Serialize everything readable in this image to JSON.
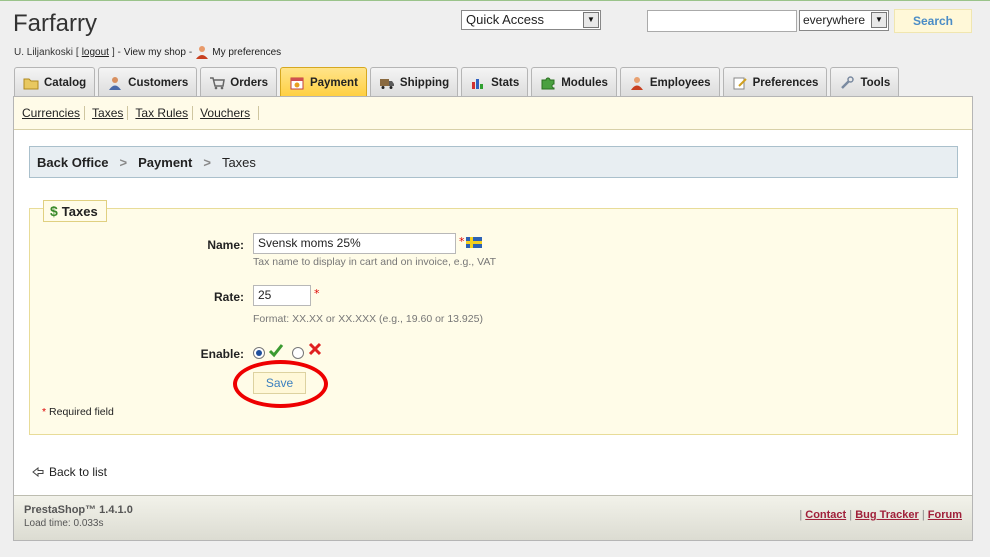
{
  "header": {
    "shop_name": "Farfarry",
    "user_name": "U. Liljankoski",
    "logout_open": "[",
    "logout_label": "logout",
    "logout_close": "] -",
    "view_shop_label": "View my shop",
    "dash": "-",
    "preferences_label": "My preferences",
    "quick_access_label": "Quick Access",
    "search_value": "",
    "search_scope": "everywhere",
    "search_button": "Search"
  },
  "tabs": [
    {
      "label": "Catalog",
      "icon": "folder-icon",
      "active": false
    },
    {
      "label": "Customers",
      "icon": "customers-icon",
      "active": false
    },
    {
      "label": "Orders",
      "icon": "cart-icon",
      "active": false
    },
    {
      "label": "Payment",
      "icon": "payment-icon",
      "active": true
    },
    {
      "label": "Shipping",
      "icon": "truck-icon",
      "active": false
    },
    {
      "label": "Stats",
      "icon": "chart-icon",
      "active": false
    },
    {
      "label": "Modules",
      "icon": "puzzle-icon",
      "active": false
    },
    {
      "label": "Employees",
      "icon": "employee-icon",
      "active": false
    },
    {
      "label": "Preferences",
      "icon": "preferences-icon",
      "active": false
    },
    {
      "label": "Tools",
      "icon": "wrench-icon",
      "active": false
    }
  ],
  "subnav": [
    "Currencies",
    "Taxes",
    "Tax Rules",
    "Vouchers"
  ],
  "breadcrumb": {
    "root": "Back Office",
    "section": "Payment",
    "current": "Taxes"
  },
  "form": {
    "legend": "Taxes",
    "name_label": "Name:",
    "name_value": "Svensk moms 25%",
    "name_hint": "Tax name to display in cart and on invoice, e.g., VAT",
    "rate_label": "Rate:",
    "rate_value": "25",
    "rate_hint": "Format: XX.XX or XX.XXX (e.g., 19.60 or 13.925)",
    "enable_label": "Enable:",
    "enabled": true,
    "save_label": "Save",
    "required_star": "*",
    "required_note": "Required field"
  },
  "back_label": "Back to list",
  "footer": {
    "version": "PrestaShop™ 1.4.1.0",
    "load_time": "Load time: 0.033s",
    "sep": "|",
    "contact": "Contact",
    "bug_tracker": "Bug Tracker",
    "forum": "Forum"
  },
  "colors": {
    "active_tab": "#ffd040",
    "annotation_circle": "#e00000",
    "link_accent": "#a0203a"
  }
}
